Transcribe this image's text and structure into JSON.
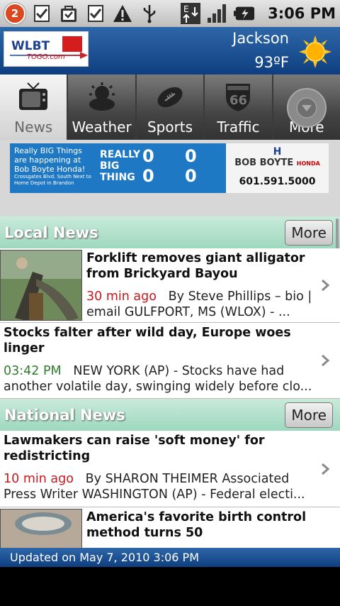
{
  "status_bar": {
    "notification_count": "2",
    "time": "3:06 PM",
    "icons": [
      "notification-badge",
      "checklist-icon",
      "bag-icon",
      "checklist-icon",
      "warning-icon",
      "usb-icon",
      "data-transfer-icon",
      "signal-icon",
      "battery-icon"
    ]
  },
  "header": {
    "logo_text": "WLBT",
    "logo_sub": "TOGO.com",
    "city": "Jackson",
    "temperature": "93ºF",
    "weather_icon": "sun-icon"
  },
  "tabs": [
    {
      "label": "News",
      "icon": "tv-icon",
      "active": true
    },
    {
      "label": "Weather",
      "icon": "cloud-sun-icon",
      "active": false
    },
    {
      "label": "Sports",
      "icon": "football-icon",
      "active": false
    },
    {
      "label": "Traffic",
      "icon": "route-66-icon",
      "active": false
    },
    {
      "label": "More",
      "icon": "chevron-down-icon",
      "active": false
    }
  ],
  "ad": {
    "left_text": "Really BIG Things are happening at Bob Boyte Honda!",
    "left_small": "Crossgates Blvd. South Next to Home Depot in Brandon",
    "big_text": "REALLY BIG THING",
    "dealer": "BOB BOYTE",
    "brand": "HONDA",
    "phone": "601.591.5000"
  },
  "sections": [
    {
      "title": "Local News",
      "more_label": "More",
      "stories": [
        {
          "title": "Forklift removes giant alligator from Brickyard Bayou",
          "time": "30 min ago",
          "time_color": "red",
          "meta": "By Steve Phillips – bio | email GULFPORT, MS (WLOX) - ...",
          "has_thumb": true
        },
        {
          "title": "Stocks falter after wild day, Europe woes linger",
          "time": "03:42 PM",
          "time_color": "green",
          "meta": "NEW YORK (AP) - Stocks have had another volatile day, swinging widely before clo...",
          "has_thumb": false
        }
      ]
    },
    {
      "title": "National News",
      "more_label": "More",
      "stories": [
        {
          "title": "Lawmakers can raise 'soft money' for redistricting",
          "time": "10 min ago",
          "time_color": "red",
          "meta": "By SHARON THEIMER Associated Press Writer WASHINGTON (AP) - Federal electi...",
          "has_thumb": false
        },
        {
          "title": "America's favorite birth control method turns 50",
          "time": "",
          "time_color": "red",
          "meta": "",
          "has_thumb": true
        }
      ]
    }
  ],
  "footer": {
    "updated_text": "Updated on May 7, 2010 3:06 PM"
  },
  "colors": {
    "header_blue": "#0e3f80",
    "section_green": "#9ed8bf",
    "time_red": "#c8171b",
    "time_green": "#2f7d2e"
  }
}
